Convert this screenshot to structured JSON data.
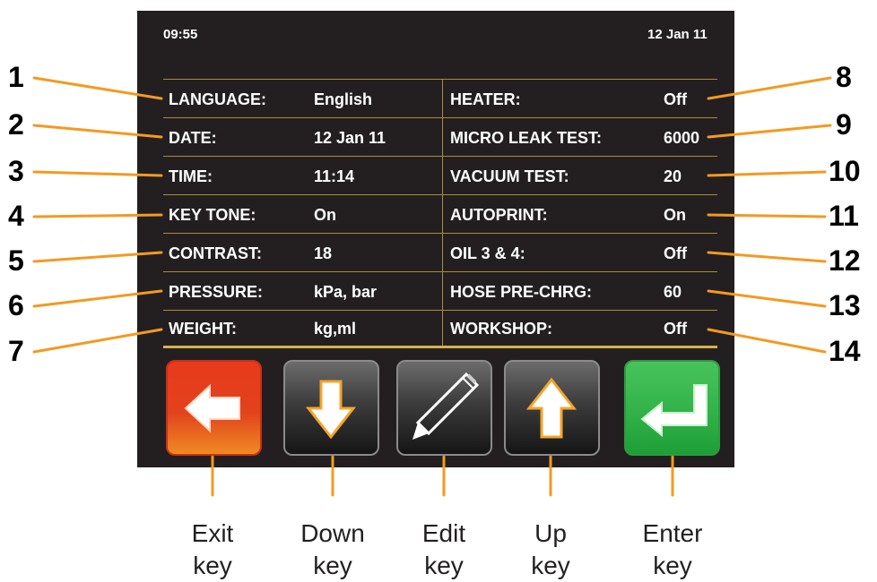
{
  "status_bar": {
    "time": "09:55",
    "date": "12 Jan 11"
  },
  "settings_left": [
    {
      "num": "1",
      "label": "LANGUAGE:",
      "value": "English"
    },
    {
      "num": "2",
      "label": "DATE:",
      "value": "12 Jan 11"
    },
    {
      "num": "3",
      "label": "TIME:",
      "value": "11:14"
    },
    {
      "num": "4",
      "label": "KEY TONE:",
      "value": "On"
    },
    {
      "num": "5",
      "label": "CONTRAST:",
      "value": "18"
    },
    {
      "num": "6",
      "label": "PRESSURE:",
      "value": "kPa, bar"
    },
    {
      "num": "7",
      "label": "WEIGHT:",
      "value": "kg,ml"
    }
  ],
  "settings_right": [
    {
      "num": "8",
      "label": "HEATER:",
      "value": "Off"
    },
    {
      "num": "9",
      "label": "MICRO LEAK TEST:",
      "value": "6000"
    },
    {
      "num": "10",
      "label": "VACUUM TEST:",
      "value": "20"
    },
    {
      "num": "11",
      "label": "AUTOPRINT:",
      "value": "On"
    },
    {
      "num": "12",
      "label": "OIL 3 & 4:",
      "value": "Off"
    },
    {
      "num": "13",
      "label": "HOSE PRE-CHRG:",
      "value": "60"
    },
    {
      "num": "14",
      "label": "WORKSHOP:",
      "value": "Off"
    }
  ],
  "keys": [
    {
      "icon": "left-arrow-icon",
      "label_line1": "Exit",
      "label_line2": "key"
    },
    {
      "icon": "down-arrow-icon",
      "label_line1": "Down",
      "label_line2": "key"
    },
    {
      "icon": "pencil-icon",
      "label_line1": "Edit",
      "label_line2": "key"
    },
    {
      "icon": "up-arrow-icon",
      "label_line1": "Up",
      "label_line2": "key"
    },
    {
      "icon": "enter-arrow-icon",
      "label_line1": "Enter",
      "label_line2": "key"
    }
  ],
  "colors": {
    "screen_bg": "#231f20",
    "grid_line": "#a98a3e",
    "exit_key": "#e2421d",
    "enter_key": "#33b24a",
    "nav_key": "#3c3c3c"
  }
}
